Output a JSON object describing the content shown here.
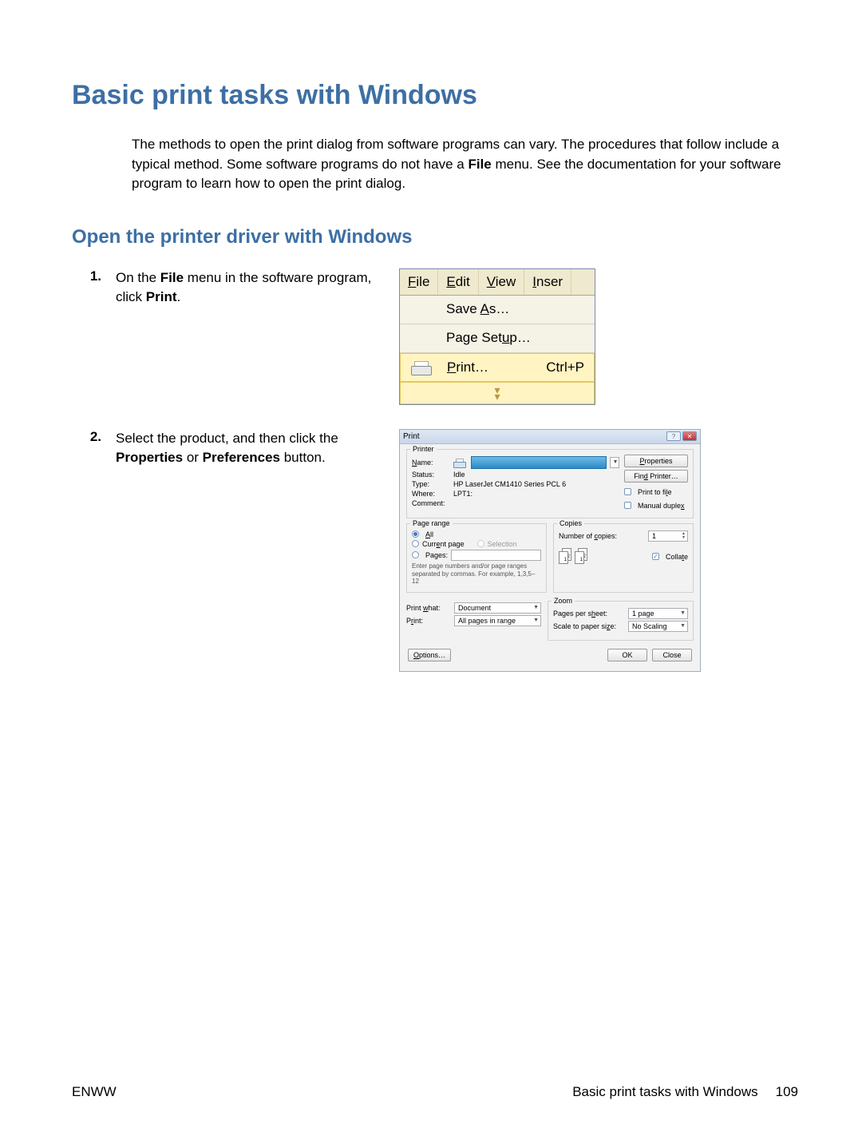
{
  "heading": "Basic print tasks with Windows",
  "intro_parts": {
    "p1": "The methods to open the print dialog from software programs can vary. The procedures that follow include a typical method. Some software programs do not have a ",
    "bold": "File",
    "p2": " menu. See the documentation for your software program to learn how to open the print dialog."
  },
  "subheading": "Open the printer driver with Windows",
  "steps": [
    {
      "num": "1.",
      "pre": "On the ",
      "b1": "File",
      "mid": " menu in the software program, click ",
      "b2": "Print",
      "post": "."
    },
    {
      "num": "2.",
      "pre": "Select the product, and then click the ",
      "b1": "Properties",
      "mid": " or ",
      "b2": "Preferences",
      "post": " button."
    }
  ],
  "filemenu": {
    "menubar": [
      "File",
      "Edit",
      "View",
      "Inser"
    ],
    "save_as": "Save As…",
    "page_setup": "Page Setup…",
    "print": "Print…",
    "print_shortcut": "Ctrl+P"
  },
  "printdlg": {
    "title": "Print",
    "printer": {
      "legend": "Printer",
      "name_label": "Name:",
      "status_label": "Status:",
      "status_value": "Idle",
      "type_label": "Type:",
      "type_value": "HP LaserJet CM1410 Series PCL 6",
      "where_label": "Where:",
      "where_value": "LPT1:",
      "comment_label": "Comment:",
      "properties_btn": "Properties",
      "find_printer_btn": "Find Printer…",
      "print_to_file": "Print to file",
      "manual_duplex": "Manual duplex"
    },
    "page_range": {
      "legend": "Page range",
      "all": "All",
      "current": "Current page",
      "selection": "Selection",
      "pages_label": "Pages:",
      "hint": "Enter page numbers and/or page ranges separated by commas. For example, 1,3,5–12"
    },
    "copies": {
      "legend": "Copies",
      "num_label": "Number of copies:",
      "num_value": "1",
      "collate": "Collate",
      "stack_labels": [
        "2",
        "1",
        "2",
        "1"
      ]
    },
    "print_what": {
      "label": "Print what:",
      "value": "Document",
      "print_label": "Print:",
      "print_value": "All pages in range"
    },
    "zoom": {
      "legend": "Zoom",
      "pps_label": "Pages per sheet:",
      "pps_value": "1 page",
      "scale_label": "Scale to paper size:",
      "scale_value": "No Scaling"
    },
    "buttons": {
      "options": "Options…",
      "ok": "OK",
      "close": "Close"
    }
  },
  "footer": {
    "left": "ENWW",
    "right": "Basic print tasks with Windows",
    "page": "109"
  }
}
